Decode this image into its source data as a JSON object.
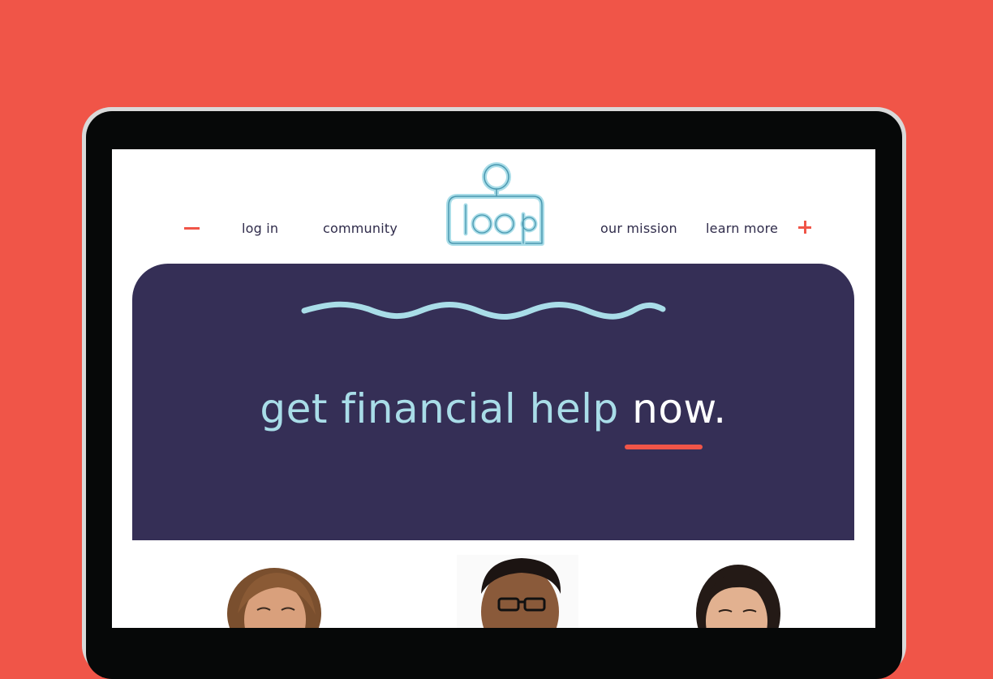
{
  "logo": {
    "text": "loop"
  },
  "nav": {
    "left_items": [
      "log in",
      "community"
    ],
    "right_items": [
      "our mission",
      "learn more"
    ],
    "minus_icon": "minus-icon",
    "plus_icon": "plus-icon"
  },
  "hero": {
    "headline_main": "get financial help ",
    "headline_emphasis": "now."
  },
  "colors": {
    "background": "#F05548",
    "hero": "#352F56",
    "accent_blue": "#A9DDE8",
    "accent_red": "#F05548",
    "nav_text": "#2f2b4a"
  },
  "photos": [
    "person-1",
    "person-2",
    "person-3"
  ]
}
